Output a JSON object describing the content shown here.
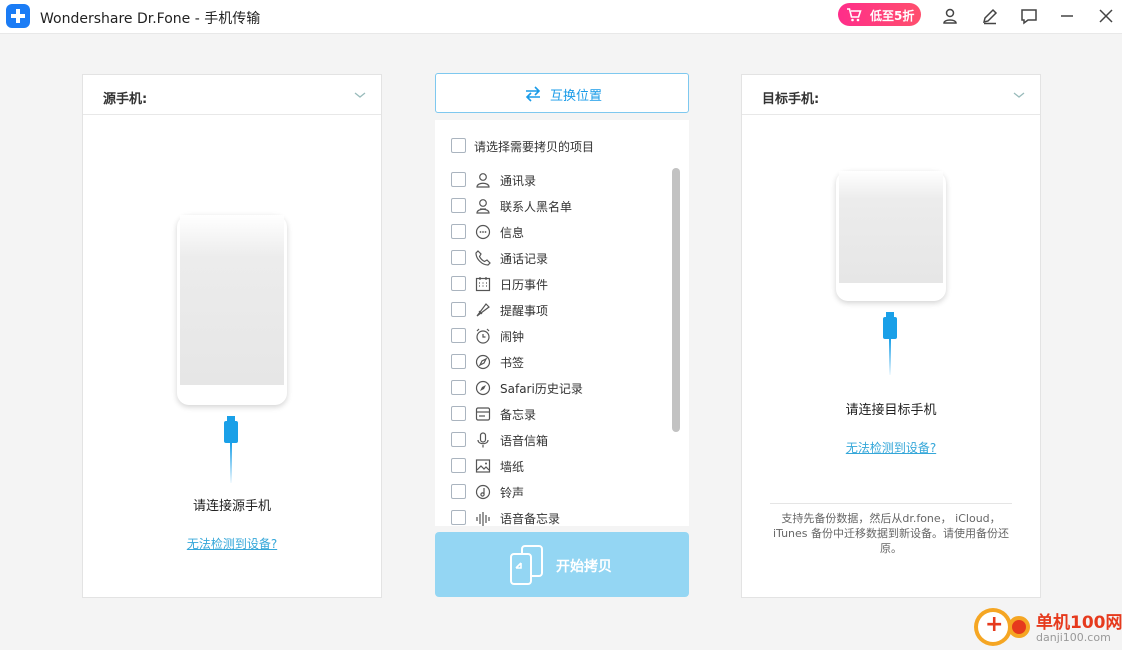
{
  "app": {
    "title": "Wondershare Dr.Fone - 手机传输"
  },
  "titlebar": {
    "promo_label": "低至5折"
  },
  "source": {
    "header_label": "源手机:",
    "connect_text": "请连接源手机",
    "detect_link": "无法检测到设备?"
  },
  "target": {
    "header_label": "目标手机:",
    "connect_text": "请连接目标手机",
    "detect_link": "无法检测到设备?",
    "help_text": "支持先备份数据，然后从dr.fone， iCloud， iTunes 备份中迁移数据到新设备。请使用备份还原。"
  },
  "swap": {
    "label": "互换位置"
  },
  "list": {
    "select_all_label": "请选择需要拷贝的项目",
    "items": [
      {
        "label": "通讯录",
        "icon": "contacts-icon"
      },
      {
        "label": "联系人黑名单",
        "icon": "blacklist-icon"
      },
      {
        "label": "信息",
        "icon": "message-icon"
      },
      {
        "label": "通话记录",
        "icon": "phone-icon"
      },
      {
        "label": "日历事件",
        "icon": "calendar-icon"
      },
      {
        "label": "提醒事项",
        "icon": "reminder-icon"
      },
      {
        "label": "闹钟",
        "icon": "alarm-icon"
      },
      {
        "label": "书签",
        "icon": "bookmark-icon"
      },
      {
        "label": "Safari历史记录",
        "icon": "safari-icon"
      },
      {
        "label": "备忘录",
        "icon": "notes-icon"
      },
      {
        "label": "语音信箱",
        "icon": "microphone-icon"
      },
      {
        "label": "墙纸",
        "icon": "wallpaper-icon"
      },
      {
        "label": "铃声",
        "icon": "ringtone-icon"
      },
      {
        "label": "语音备忘录",
        "icon": "voice-memo-icon"
      }
    ]
  },
  "start": {
    "label": "开始拷贝"
  },
  "watermark": {
    "name": "单机100网",
    "url": "danji100.com"
  },
  "colors": {
    "accent": "#1a9be8",
    "promo": "#ff2d8a",
    "start_disabled": "#94d6f3"
  }
}
